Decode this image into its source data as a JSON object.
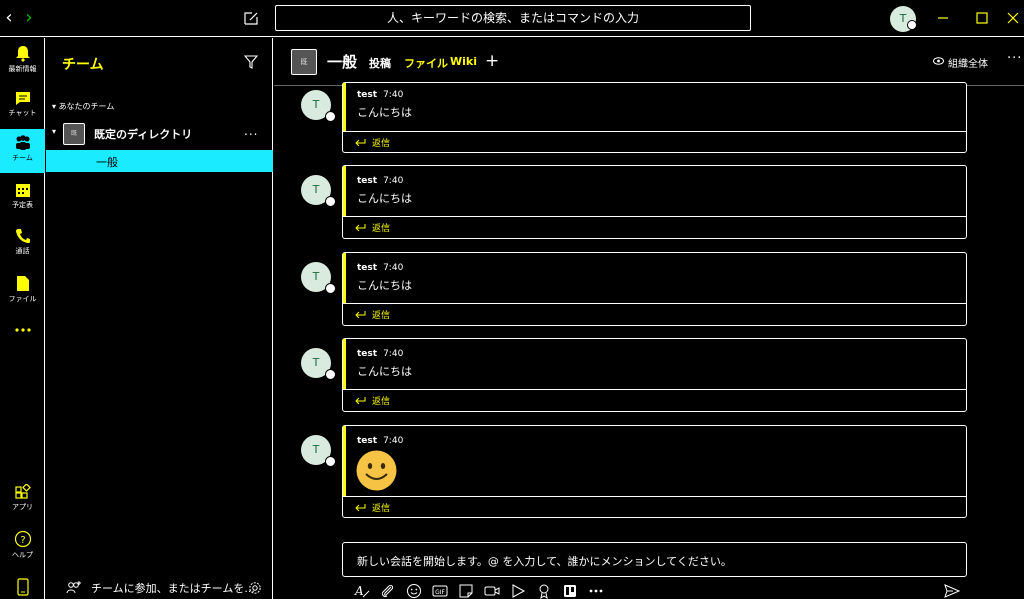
{
  "titlebar": {
    "search_placeholder": "人、キーワードの検索、またはコマンドの入力",
    "me_initial": "T",
    "icons": [
      "chevron-left-icon",
      "chevron-right-icon",
      "compose-icon",
      "minimize-icon",
      "maximize-icon",
      "close-icon"
    ]
  },
  "rail": {
    "items": [
      {
        "label": "最新情報",
        "icon": "bell-icon"
      },
      {
        "label": "チャット",
        "icon": "chat-icon"
      },
      {
        "label": "チーム",
        "icon": "teams-icon",
        "active": true
      },
      {
        "label": "予定表",
        "icon": "calendar-icon"
      },
      {
        "label": "通話",
        "icon": "phone-icon"
      },
      {
        "label": "ファイル",
        "icon": "file-icon"
      },
      {
        "label": "…",
        "icon": "more-icon"
      }
    ],
    "bottom": [
      {
        "label": "アプリ",
        "icon": "apps-icon"
      },
      {
        "label": "ヘルプ",
        "icon": "help-icon"
      },
      {
        "label": "",
        "icon": "mobile-icon"
      }
    ]
  },
  "teams_pane": {
    "title": "チーム",
    "section": "あなたのチーム",
    "team": {
      "tile": "既",
      "name": "既定のディレクトリ",
      "more": "..."
    },
    "channel": "一般",
    "join": "チームに参加、またはチームを..."
  },
  "channel": {
    "tile": "既",
    "title": "一般",
    "tabs": {
      "posts": "投稿",
      "files": "ファイル",
      "wiki": "Wiki",
      "add": "+"
    },
    "org_wide": "組織全体",
    "more": "···"
  },
  "messages": [
    {
      "initial": "T",
      "author": "test",
      "time": "7:40",
      "text": "こんにちは",
      "reply": "返信"
    },
    {
      "initial": "T",
      "author": "test",
      "time": "7:40",
      "text": "こんにちは",
      "reply": "返信"
    },
    {
      "initial": "T",
      "author": "test",
      "time": "7:40",
      "text": "こんにちは",
      "reply": "返信"
    },
    {
      "initial": "T",
      "author": "test",
      "time": "7:40",
      "text": "こんにちは",
      "reply": "返信"
    },
    {
      "initial": "T",
      "author": "test",
      "time": "7:40",
      "text": "",
      "emoji": "smile-emoji",
      "reply": "返信"
    }
  ],
  "compose": {
    "placeholder": "新しい会話を開始します。@ を入力して、誰かにメンションしてください。",
    "tools": [
      "format-icon",
      "attach-icon",
      "emoji-icon",
      "gif-icon",
      "sticker-icon",
      "meet-icon",
      "stream-icon",
      "praise-icon",
      "trello-icon",
      "more-icon"
    ],
    "send_icon": "send-icon"
  },
  "colors": {
    "accent": "#ffff00",
    "highlight": "#1aebff",
    "background": "#000000",
    "avatar_bg": "#d9eadf"
  }
}
